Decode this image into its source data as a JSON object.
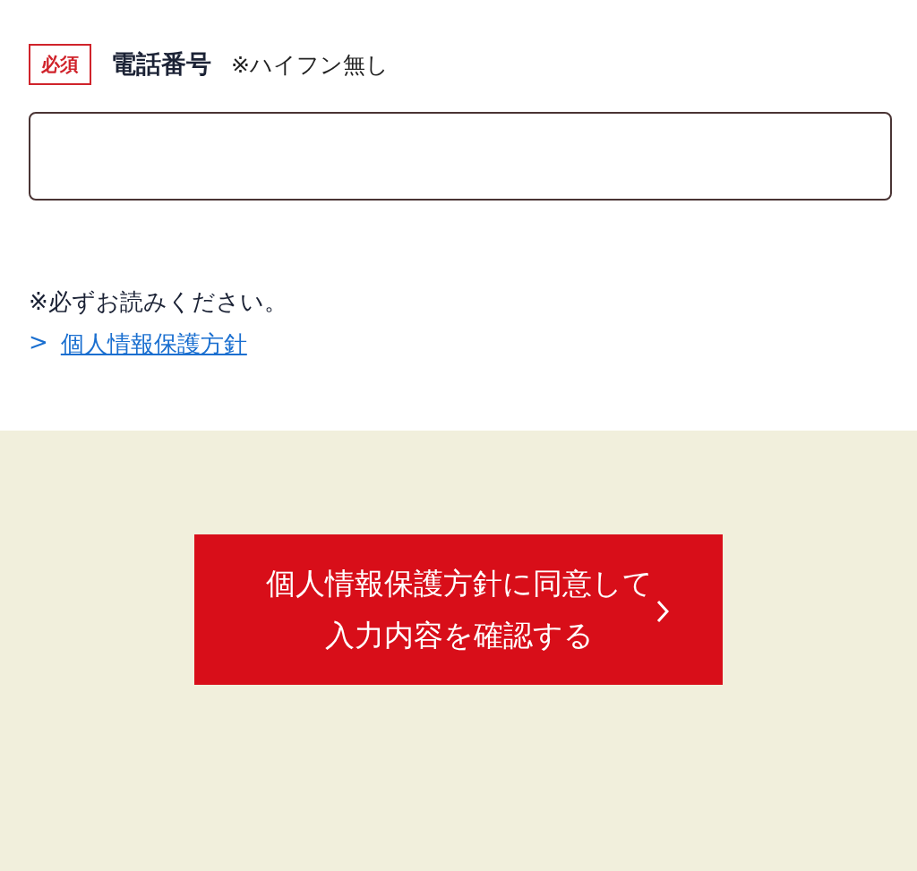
{
  "field": {
    "required_badge": "必須",
    "label": "電話番号",
    "note": "※ハイフン無し"
  },
  "notice": {
    "text": "※必ずお読みください。",
    "link_marker": ">",
    "link": "個人情報保護方針"
  },
  "submit_button": {
    "lines": [
      "個人情報保護方針に同意して",
      "入力内容を確認する"
    ]
  }
}
